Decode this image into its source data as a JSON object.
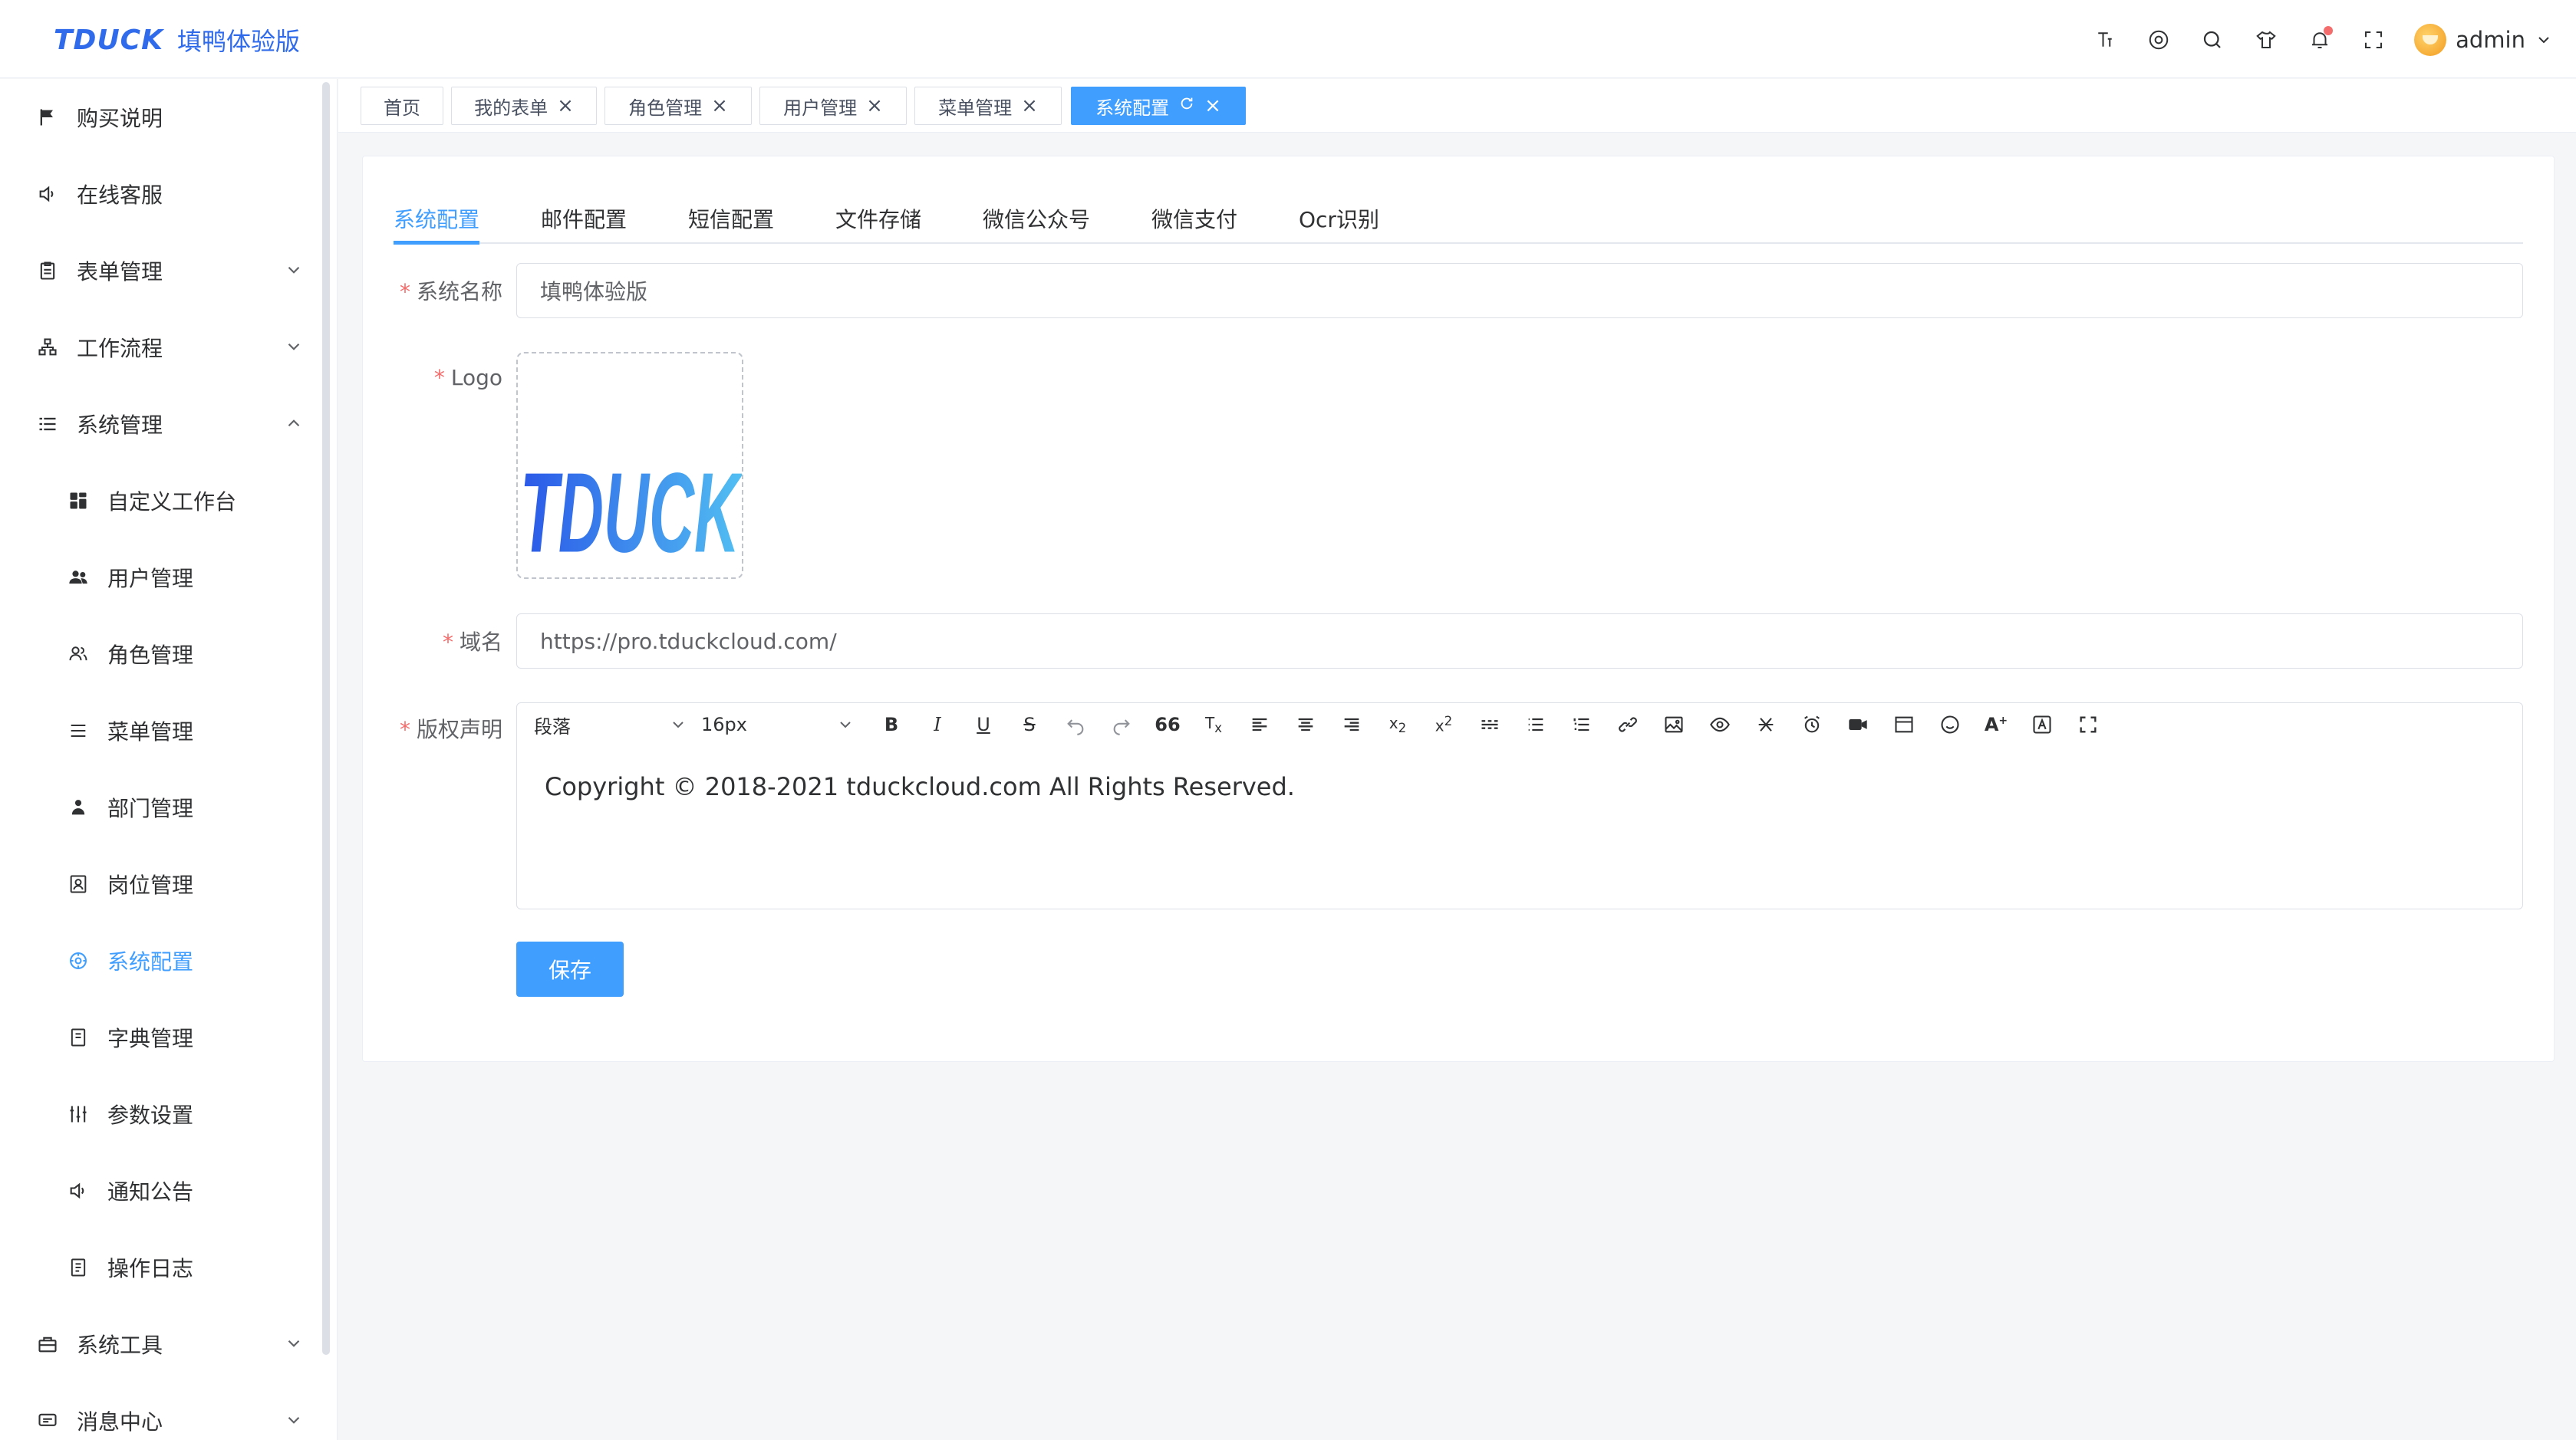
{
  "brand": {
    "logo_text": "TDUCK",
    "app_name": "填鸭体验版"
  },
  "header": {
    "icons": [
      "font-size-icon",
      "github-icon",
      "search-icon",
      "theme-icon",
      "bell-icon",
      "fullscreen-icon"
    ],
    "user_name": "admin"
  },
  "sidebar": {
    "items": [
      {
        "label": "购买说明",
        "icon": "flag-icon"
      },
      {
        "label": "在线客服",
        "icon": "speaker-icon"
      },
      {
        "label": "表单管理",
        "icon": "clipboard-icon",
        "expandable": true
      },
      {
        "label": "工作流程",
        "icon": "flow-icon",
        "expandable": true
      },
      {
        "label": "系统管理",
        "icon": "list-icon",
        "expandable": true,
        "expanded": true
      },
      {
        "label": "自定义工作台",
        "icon": "dashboard-icon"
      },
      {
        "label": "用户管理",
        "icon": "users-icon"
      },
      {
        "label": "角色管理",
        "icon": "role-icon"
      },
      {
        "label": "菜单管理",
        "icon": "menu-icon"
      },
      {
        "label": "部门管理",
        "icon": "dept-icon"
      },
      {
        "label": "岗位管理",
        "icon": "post-icon"
      },
      {
        "label": "系统配置",
        "icon": "settings-icon",
        "active": true
      },
      {
        "label": "字典管理",
        "icon": "dict-icon"
      },
      {
        "label": "参数设置",
        "icon": "sliders-icon"
      },
      {
        "label": "通知公告",
        "icon": "speaker-icon"
      },
      {
        "label": "操作日志",
        "icon": "log-icon"
      },
      {
        "label": "系统工具",
        "icon": "toolbox-icon",
        "expandable": true
      },
      {
        "label": "消息中心",
        "icon": "message-icon",
        "expandable": true
      }
    ]
  },
  "tags": [
    {
      "label": "首页",
      "closable": false
    },
    {
      "label": "我的表单",
      "closable": true
    },
    {
      "label": "角色管理",
      "closable": true
    },
    {
      "label": "用户管理",
      "closable": true
    },
    {
      "label": "菜单管理",
      "closable": true
    },
    {
      "label": "系统配置",
      "closable": true,
      "active": true
    }
  ],
  "tabs": [
    "系统配置",
    "邮件配置",
    "短信配置",
    "文件存储",
    "微信公众号",
    "微信支付",
    "Ocr识别"
  ],
  "form": {
    "system_name_label": "系统名称",
    "system_name_value": "填鸭体验版",
    "logo_label": "Logo",
    "logo_text": "TDUCK",
    "domain_label": "域名",
    "domain_value": "https://pro.tduckcloud.com/",
    "copyright_label": "版权声明",
    "copyright_value": "Copyright © 2018-2021 tduckcloud.com All Rights Reserved.",
    "save_label": "保存"
  },
  "editor": {
    "paragraph_select": "段落",
    "font_size_select": "16px",
    "tools": [
      "bold-icon",
      "italic-icon",
      "underline-icon",
      "strikethrough-icon",
      "undo-icon",
      "redo-icon",
      "quote-icon",
      "clear-format-icon",
      "align-left-icon",
      "align-center-icon",
      "align-right-icon",
      "subscript-icon",
      "superscript-icon",
      "divider-icon",
      "bullet-list-icon",
      "ordered-list-icon",
      "link-icon",
      "image-icon",
      "preview-icon",
      "code-icon",
      "timer-icon",
      "video-icon",
      "table-icon",
      "emoji-icon",
      "font-color-icon",
      "bg-color-icon",
      "fullscreen-icon"
    ]
  },
  "colors": {
    "primary": "#409eff",
    "brand": "#2f6bea",
    "required": "#f56c6c"
  }
}
